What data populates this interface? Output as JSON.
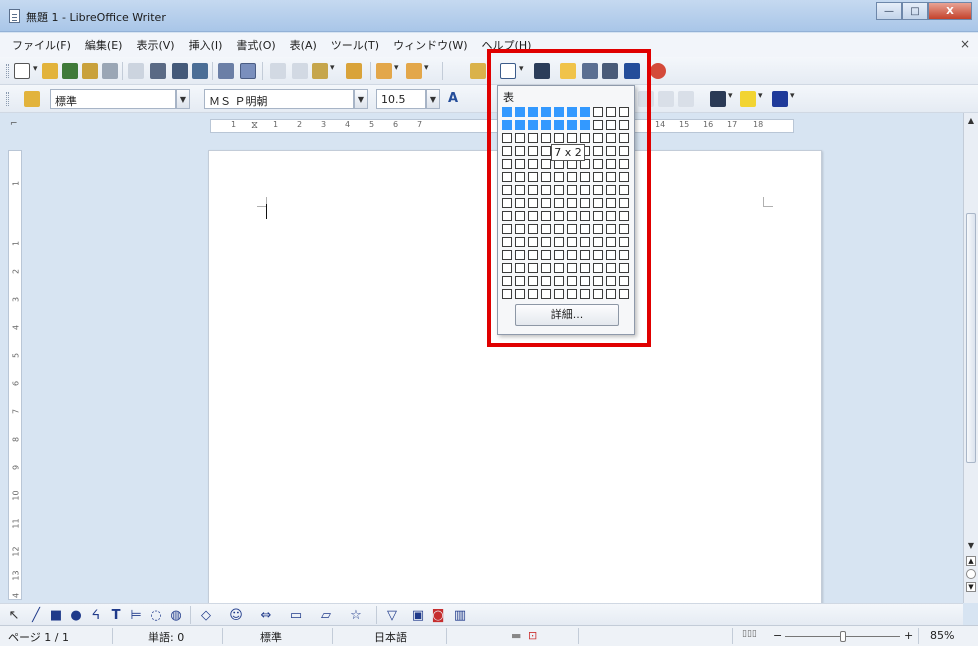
{
  "window": {
    "title": "無題 1 - LibreOffice Writer",
    "minimize_glyph": "—",
    "maximize_glyph": "□",
    "close_glyph": "X"
  },
  "menubar": {
    "items": [
      "ファイル(F)",
      "編集(E)",
      "表示(V)",
      "挿入(I)",
      "書式(O)",
      "表(A)",
      "ツール(T)",
      "ウィンドウ(W)",
      "ヘルプ(H)"
    ],
    "close_glyph": "×"
  },
  "format_toolbar": {
    "style": "標準",
    "font": "ＭＳ Ｐ明朝",
    "size": "10.5"
  },
  "ruler": {
    "ticks": [
      "1",
      "1",
      "2",
      "3",
      "4",
      "5",
      "6",
      "7",
      "14",
      "15",
      "16",
      "17",
      "18"
    ],
    "vticks": [
      "1",
      "1",
      "2",
      "3",
      "4",
      "5",
      "6",
      "7",
      "8",
      "9",
      "10",
      "11",
      "12",
      "13",
      "4"
    ]
  },
  "table_dropdown": {
    "title": "表",
    "columns": 10,
    "rows": 15,
    "selected_cols": 7,
    "selected_rows": 2,
    "size_label": "7 x 2",
    "more_button": "詳細..."
  },
  "statusbar": {
    "page": "ページ 1 / 1",
    "words": "単語: 0",
    "style": "標準",
    "language": "日本語",
    "zoom": "85%",
    "zoom_minus": "−",
    "zoom_plus": "+"
  },
  "colors": {
    "selection": "#3399ff",
    "highlight": "#e00000"
  }
}
